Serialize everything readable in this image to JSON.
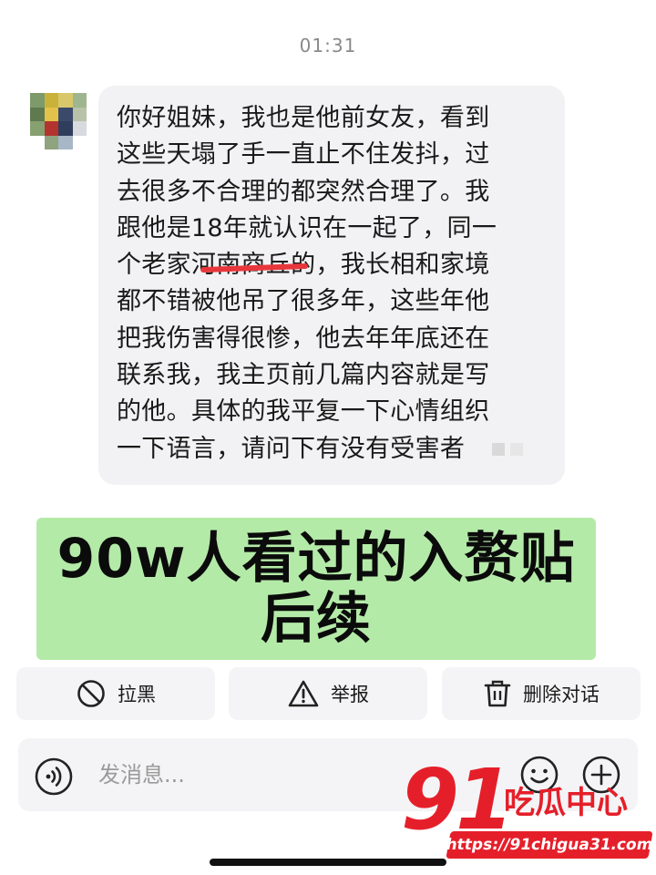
{
  "status": {
    "time": "01:31"
  },
  "message": {
    "lines": [
      "你好姐妹，我也是他前女友，看到",
      "这些天塌了手一直止不住发抖，过",
      "去很多不合理的都突然合理了。我",
      "跟他是18年就认识在一起了，同一",
      "个老家河南商丘的，我长相和家境",
      "都不错被他吊了很多年，这些年他",
      "把我伤害得很惨，他去年年底还在",
      "联系我，我主页前几篇内容就是写",
      "的他。具体的我平复一下心情组织",
      "一下语言，请问下有没有受害者"
    ]
  },
  "banner": {
    "line1": "90w人看过的入赘贴",
    "line2": "后续"
  },
  "actions": {
    "block_label": "拉黑",
    "report_label": "举报",
    "delete_label": "删除对话"
  },
  "composer": {
    "placeholder": "发消息..."
  },
  "watermark": {
    "number": "91",
    "brand": "吃瓜中心",
    "url": "https://91chigua31.com"
  },
  "icons": {
    "block": "block-icon",
    "report": "warning-icon",
    "delete": "trash-icon",
    "voice": "voice-icon",
    "emoji": "emoji-icon",
    "plus": "plus-icon"
  },
  "colors": {
    "banner_bg": "#b4eaa8",
    "bubble_bg": "#f2f2f4",
    "watermark_red": "#e51f2a"
  }
}
